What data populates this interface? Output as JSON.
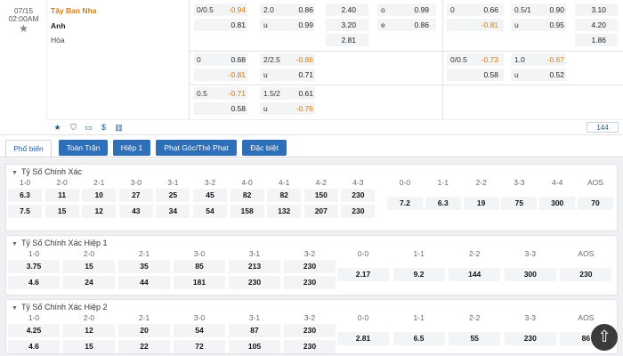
{
  "match": {
    "date": "07/15",
    "time": "02:00AM",
    "home": "Tây Ban Nha",
    "away": "Anh",
    "draw": "Hòa",
    "count": "144"
  },
  "odds": {
    "row1": {
      "ah1": {
        "line": "0/0.5",
        "v1": "-0.94",
        "v2": "0.81"
      },
      "ou1": {
        "line": "2.0",
        "lineU": "u",
        "v1": "0.86",
        "v2": "0.99"
      },
      "x12a": {
        "v1": "2.40",
        "v2": "3.20",
        "v3": "2.81"
      },
      "oe": {
        "o": "o",
        "e": "e",
        "v1": "0.99",
        "v2": "0.86"
      },
      "ah2": {
        "line": "0",
        "v1": "0.66",
        "v2": "-0.81"
      },
      "ou2": {
        "line": "0.5/1",
        "lineU": "u",
        "v1": "0.90",
        "v2": "0.95"
      },
      "x12b": {
        "v1": "3.10",
        "v2": "4.20",
        "v3": "1.86"
      }
    },
    "row2": {
      "ah1": {
        "line": "0",
        "v1": "0.68",
        "v2": "-0.81"
      },
      "ou1": {
        "line": "2/2.5",
        "lineU": "u",
        "v1": "-0.86",
        "v2": "0.71"
      },
      "ah2": {
        "line": "0/0.5",
        "v1": "-0.73",
        "v2": "0.58"
      },
      "ou2": {
        "line": "1.0",
        "lineU": "u",
        "v1": "-0.67",
        "v2": "0.52"
      }
    },
    "row3": {
      "ah1": {
        "line": "0.5",
        "v1": "-0.71",
        "v2": "0.58"
      },
      "ou1": {
        "line": "1.5/2",
        "lineU": "u",
        "v1": "0.61",
        "v2": "-0.76"
      }
    }
  },
  "icons": [
    "star-icon",
    "shirt-icon",
    "tv-icon",
    "dollar-icon",
    "chart-icon"
  ],
  "tabs": [
    "Phổ biến",
    "Toàn Trận",
    "Hiệp 1",
    "Phạt Góc/Thẻ Phạt",
    "Đặc biệt"
  ],
  "sections": [
    {
      "title": "Tỷ Số Chính Xác",
      "homeHeads": [
        "1-0",
        "2-0",
        "2-1",
        "3-0",
        "3-1",
        "3-2",
        "4-0",
        "4-1",
        "4-2",
        "4-3"
      ],
      "homeVals": [
        "6.3",
        "11",
        "10",
        "27",
        "25",
        "45",
        "82",
        "82",
        "150",
        "230"
      ],
      "awayVals": [
        "7.5",
        "15",
        "12",
        "43",
        "34",
        "54",
        "158",
        "132",
        "207",
        "230"
      ],
      "drawHeads": [
        "0-0",
        "1-1",
        "2-2",
        "3-3",
        "4-4",
        "AOS"
      ],
      "drawVals": [
        "7.2",
        "6.3",
        "19",
        "75",
        "300",
        "70"
      ]
    },
    {
      "title": "Tỷ Số Chính Xác Hiệp 1",
      "homeHeads": [
        "1-0",
        "2-0",
        "2-1",
        "3-0",
        "3-1",
        "3-2"
      ],
      "homeVals": [
        "3.75",
        "15",
        "35",
        "85",
        "213",
        "230"
      ],
      "awayVals": [
        "4.6",
        "24",
        "44",
        "181",
        "230",
        "230"
      ],
      "drawHeads": [
        "0-0",
        "1-1",
        "2-2",
        "3-3",
        "AOS"
      ],
      "drawVals": [
        "2.17",
        "9.2",
        "144",
        "300",
        "230"
      ]
    },
    {
      "title": "Tỷ Số Chính Xác Hiệp 2",
      "homeHeads": [
        "1-0",
        "2-0",
        "2-1",
        "3-0",
        "3-1",
        "3-2"
      ],
      "homeVals": [
        "4.25",
        "12",
        "20",
        "54",
        "87",
        "230"
      ],
      "awayVals": [
        "4.6",
        "15",
        "22",
        "72",
        "105",
        "230"
      ],
      "drawHeads": [
        "0-0",
        "1-1",
        "2-2",
        "3-3",
        "AOS"
      ],
      "drawVals": [
        "2.81",
        "6.5",
        "55",
        "230",
        "86"
      ]
    }
  ],
  "colors": {
    "accent": "#e07b0b",
    "tabBlue": "#2e6fb8",
    "link": "#1b5ea8"
  }
}
